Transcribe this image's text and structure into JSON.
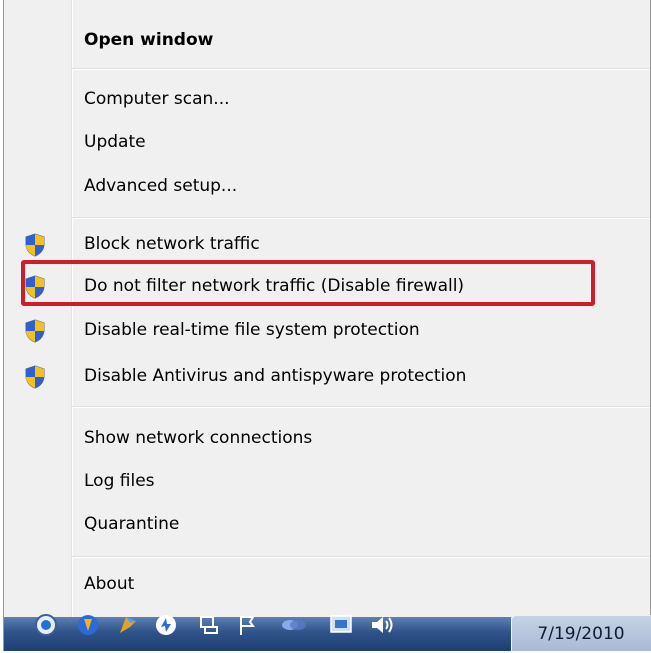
{
  "menu": {
    "open_window": "Open window",
    "computer_scan": "Computer scan...",
    "update": "Update",
    "advanced_setup": "Advanced setup...",
    "block_network": "Block network traffic",
    "do_not_filter": "Do not filter network traffic (Disable firewall)",
    "disable_realtime": "Disable real-time file system protection",
    "disable_antivirus": "Disable Antivirus and antispyware protection",
    "show_connections": "Show network connections",
    "log_files": "Log files",
    "quarantine": "Quarantine",
    "about": "About"
  },
  "taskbar": {
    "clock_date": "7/19/2010"
  },
  "icons": {
    "shield": "uac-shield-icon"
  },
  "colors": {
    "highlight_border": "#cc1f2b",
    "menu_bg": "#f0f0f0",
    "taskbar": "#2f5389"
  }
}
